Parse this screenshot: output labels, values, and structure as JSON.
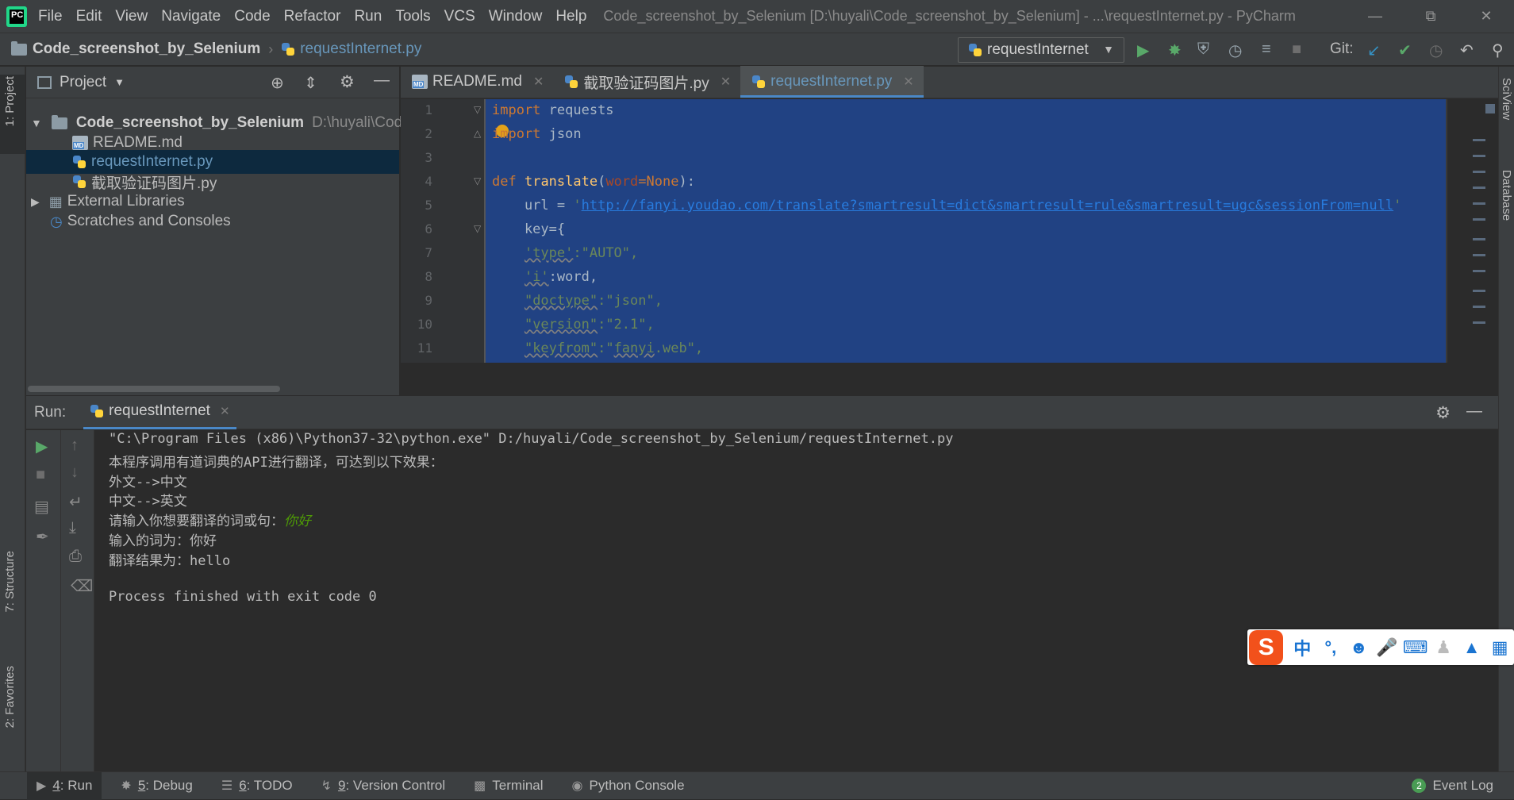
{
  "app": {
    "title": "Code_screenshot_by_Selenium [D:\\huyali\\Code_screenshot_by_Selenium] - ...\\requestInternet.py - PyCharm",
    "menu": [
      "File",
      "Edit",
      "View",
      "Navigate",
      "Code",
      "Refactor",
      "Run",
      "Tools",
      "VCS",
      "Window",
      "Help"
    ],
    "accent": "#4a88c7"
  },
  "navbar": {
    "project": "Code_screenshot_by_Selenium",
    "file": "requestInternet.py",
    "run_config": "requestInternet",
    "git_label": "Git:"
  },
  "left_strip": {
    "project_tab": "1: Project",
    "structure_tab": "7: Structure",
    "favorites_tab": "2: Favorites"
  },
  "right_strip": {
    "sciview_tab": "SciView",
    "database_tab": "Database"
  },
  "project_panel": {
    "title": "Project",
    "root_name": "Code_screenshot_by_Selenium",
    "root_path": "D:\\huyali\\Code",
    "files": [
      "README.md",
      "requestInternet.py",
      "截取验证码图片.py"
    ],
    "external": "External Libraries",
    "scratches": "Scratches and Consoles"
  },
  "editor": {
    "tabs": [
      {
        "label": "README.md"
      },
      {
        "label": "截取验证码图片.py"
      },
      {
        "label": "requestInternet.py"
      }
    ],
    "line_numbers": [
      "1",
      "2",
      "3",
      "4",
      "5",
      "6",
      "7",
      "8",
      "9",
      "10",
      "11"
    ]
  },
  "code": {
    "l1_kw": "import",
    "l1_rest": " requests",
    "l2_kw": "import",
    "l2_rest": " json",
    "l4_kw": "def",
    "l4_fn": "translate",
    "l4_open": "(",
    "l4_par": "word",
    "l4_eq": "=",
    "l4_none": "None",
    "l4_close": "):",
    "l5_pre": "    url = ",
    "l5_q1": "'",
    "l5_url": "http://fanyi.youdao.com/translate?smartresult=dict&smartresult=rule&smartresult=ugc&sessionFrom=null",
    "l5_q2": "'",
    "l6": "    key={",
    "l7_key": "'type'",
    "l7_rest": ":\"AUTO\",",
    "l8_key": "'i'",
    "l8_rest": ":word,",
    "l9_key": "\"doctype\"",
    "l9_rest": ":\"json\",",
    "l10_key": "\"version\"",
    "l10_rest": ":\"2.1\",",
    "l11_key": "\"keyfrom\"",
    "l11_q": ":\"",
    "l11_val": "fanyi",
    "l11_end": ".web\","
  },
  "run_panel": {
    "label": "Run:",
    "tab": "requestInternet",
    "output": [
      "\"C:\\Program Files (x86)\\Python37-32\\python.exe\" D:/huyali/Code_screenshot_by_Selenium/requestInternet.py",
      "本程序调用有道词典的API进行翻译，可达到以下效果：",
      "外文-->中文",
      "中文-->英文",
      "请输入你想要翻译的词或句：",
      "输入的词为：你好",
      "翻译结果为：hello",
      "",
      "Process finished with exit code 0"
    ],
    "user_input": "你好"
  },
  "bottom_tabs": [
    {
      "num": "4",
      "label": ": Run"
    },
    {
      "num": "5",
      "label": ": Debug"
    },
    {
      "num": "6",
      "label": ": TODO"
    },
    {
      "num": "9",
      "label": ": Version Control"
    },
    {
      "num": "",
      "label": "Terminal"
    },
    {
      "num": "",
      "label": "Python Console"
    }
  ],
  "event_log": {
    "count": "2",
    "label": "Event Log"
  },
  "ime": {
    "logo": "S",
    "mode": "中",
    "punct": "°,"
  }
}
